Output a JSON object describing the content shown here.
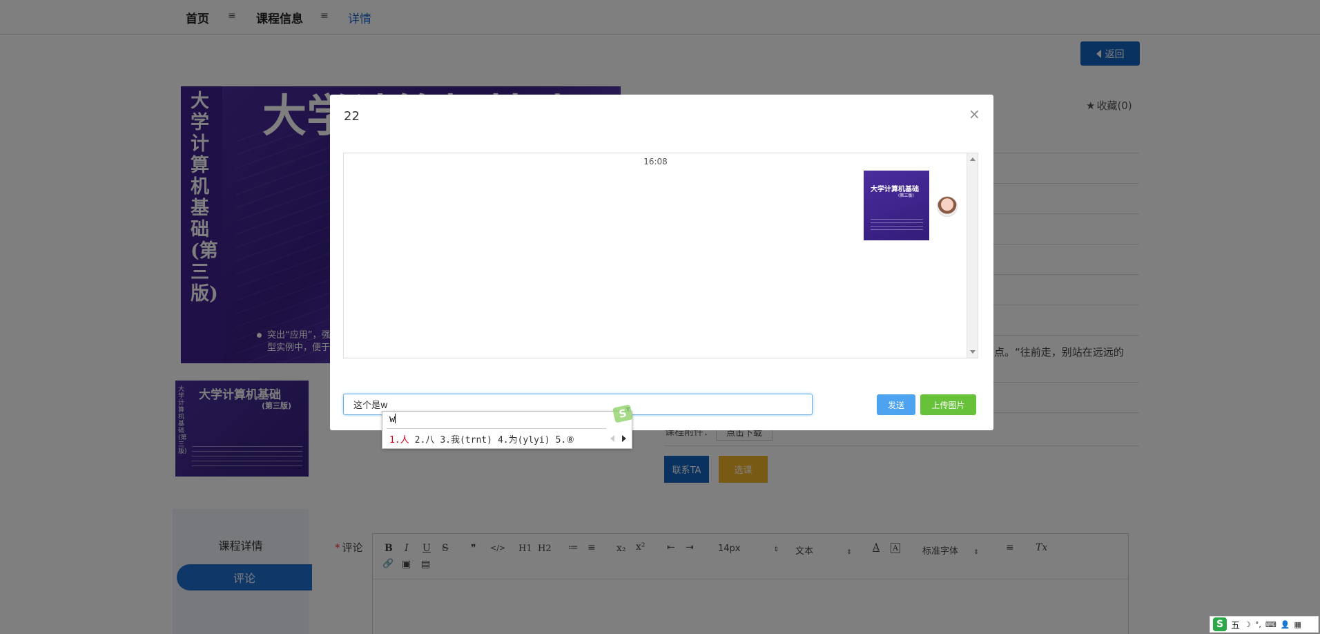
{
  "nav": {
    "home": "首页",
    "sep": "≡",
    "course_info": "课程信息",
    "detail": "详情"
  },
  "back_button": "返回",
  "favorite": {
    "icon": "star-icon",
    "label": "收藏(0)"
  },
  "cover_big": {
    "vertical_title": "大学计算机基础(第三版)",
    "title": "大学计算机基础",
    "bullet_line1": "突出“应用”，强",
    "bullet_line2": "型实例中，便于"
  },
  "cover_small": {
    "title": "大学计算机基础",
    "subtitle": "(第三版)",
    "vertical": "大学计算机基础(第三版)"
  },
  "description_partial": "点。“往前走，别站在远远的",
  "attachment": {
    "label": "课程附件：",
    "button": "点击下载"
  },
  "contact_button": "联系TA",
  "select_button": "选课",
  "side_panel": {
    "title": "课程详情",
    "active_item": "评论"
  },
  "comment": {
    "required_mark": "*",
    "label": "评论"
  },
  "editor_toolbar": {
    "bold": "B",
    "italic": "I",
    "underline": "U",
    "strike": "S",
    "quote": "❞",
    "code": "</>",
    "h1": "H1",
    "h2": "H2",
    "ol": "≔",
    "ul": "≡",
    "sub": "x₂",
    "sup": "x²",
    "outdent": "⇤",
    "indent": "⇥",
    "font_size": "14px",
    "text_type": "文本",
    "text_color": "A",
    "bg_color": "A",
    "font_family": "标准字体",
    "align": "≡",
    "clear": "Tx",
    "link": "🔗",
    "image": "▣",
    "video": "▤"
  },
  "modal": {
    "title": "22",
    "close": "×",
    "chat_time": "16:08",
    "chat_image": {
      "title": "大学计算机基础",
      "subtitle": "(第三版)"
    },
    "input_value": "这个是w",
    "send_button": "发送",
    "upload_button": "上传图片"
  },
  "ime": {
    "composition": "w",
    "candidates": [
      "1.人",
      "2.八",
      "3.我(trnt)",
      "4.为(ylyi)",
      "5.⑧"
    ],
    "logo": "S"
  },
  "ime_bar": {
    "logo": "S",
    "mode": "五",
    "icons": [
      "☽",
      "°,",
      "⌨",
      "👤",
      "▦"
    ]
  }
}
